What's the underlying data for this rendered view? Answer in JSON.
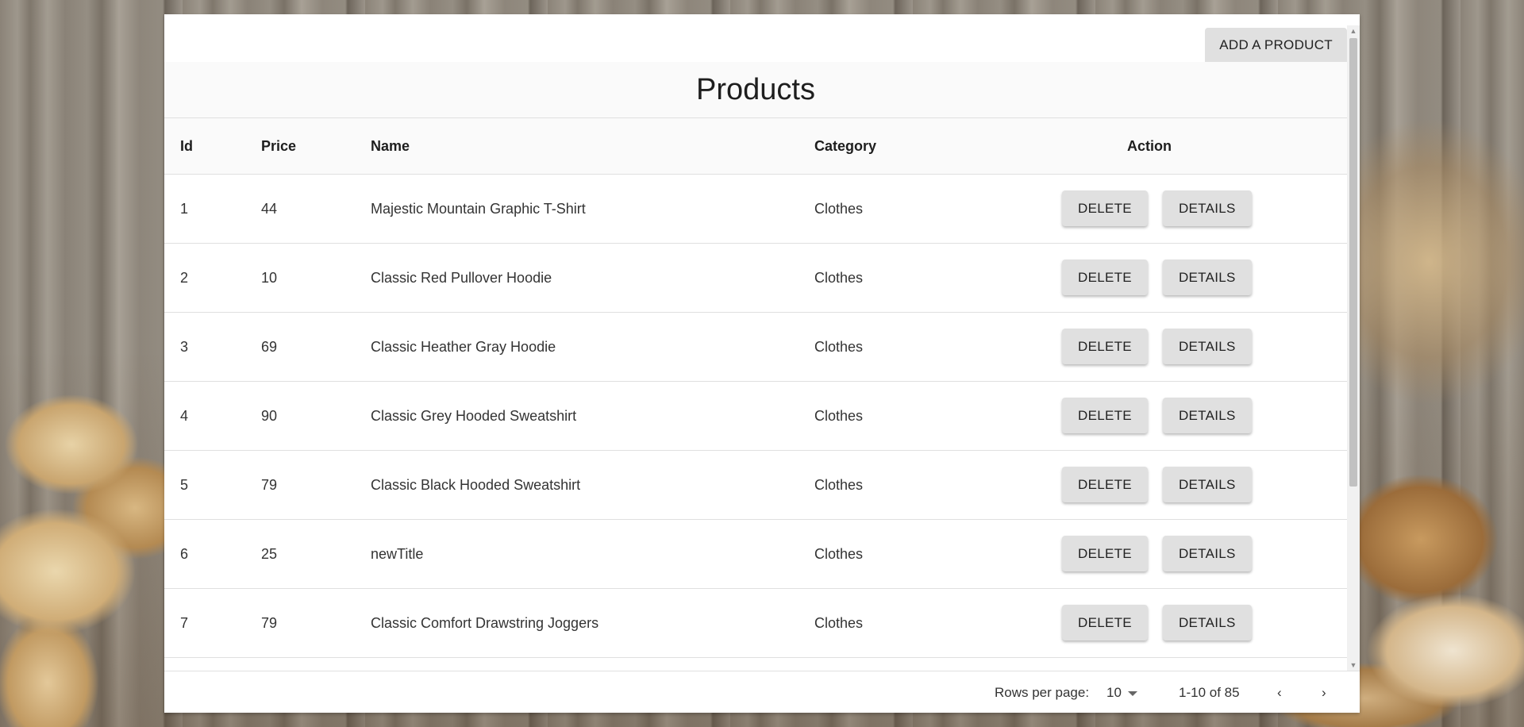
{
  "toolbar": {
    "add_label": "ADD A PRODUCT"
  },
  "page": {
    "title": "Products"
  },
  "table": {
    "headers": {
      "id": "Id",
      "price": "Price",
      "name": "Name",
      "category": "Category",
      "action": "Action"
    },
    "rows": [
      {
        "id": "1",
        "price": "44",
        "name": "Majestic Mountain Graphic T-Shirt",
        "category": "Clothes",
        "delete": "DELETE",
        "details": "DETAILS"
      },
      {
        "id": "2",
        "price": "10",
        "name": "Classic Red Pullover Hoodie",
        "category": "Clothes",
        "delete": "DELETE",
        "details": "DETAILS"
      },
      {
        "id": "3",
        "price": "69",
        "name": "Classic Heather Gray Hoodie",
        "category": "Clothes",
        "delete": "DELETE",
        "details": "DETAILS"
      },
      {
        "id": "4",
        "price": "90",
        "name": "Classic Grey Hooded Sweatshirt",
        "category": "Clothes",
        "delete": "DELETE",
        "details": "DETAILS"
      },
      {
        "id": "5",
        "price": "79",
        "name": "Classic Black Hooded Sweatshirt",
        "category": "Clothes",
        "delete": "DELETE",
        "details": "DETAILS"
      },
      {
        "id": "6",
        "price": "25",
        "name": "newTitle",
        "category": "Clothes",
        "delete": "DELETE",
        "details": "DETAILS"
      },
      {
        "id": "7",
        "price": "79",
        "name": "Classic Comfort Drawstring Joggers",
        "category": "Clothes",
        "delete": "DELETE",
        "details": "DETAILS"
      }
    ]
  },
  "pagination": {
    "rows_per_page_label": "Rows per page:",
    "rows_per_page_value": "10",
    "range": "1-10 of 85",
    "prev_icon": "chevron-left-icon",
    "next_icon": "chevron-right-icon"
  },
  "icons": {
    "select_caret": "caret-down-icon",
    "scroll_up": "scroll-up-arrow-icon",
    "scroll_down": "scroll-down-arrow-icon"
  },
  "colors": {
    "button_bg": "#e0e0e0",
    "header_bg": "#fafafa",
    "divider": "#e0e0e0"
  }
}
